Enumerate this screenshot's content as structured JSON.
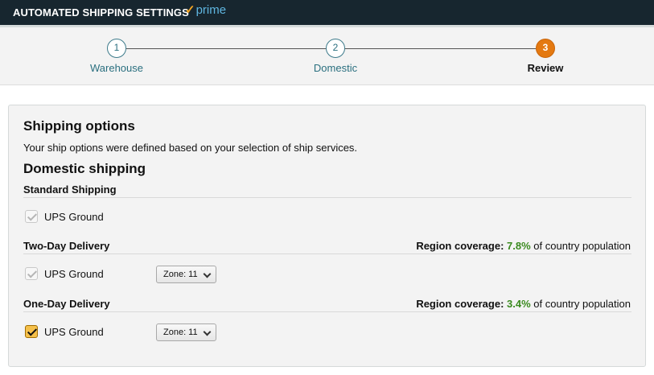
{
  "header": {
    "title": "AUTOMATED SHIPPING SETTINGS",
    "prime_check": "✓",
    "prime_label": "prime",
    "colors": {
      "background": "#17262f",
      "prime": "#5fb6e0",
      "check": "#f5a623"
    }
  },
  "stepper": {
    "steps": [
      {
        "number": "1",
        "label": "Warehouse",
        "state": "done"
      },
      {
        "number": "2",
        "label": "Domestic",
        "state": "done"
      },
      {
        "number": "3",
        "label": "Review",
        "state": "active"
      }
    ],
    "active_color": "#e47911"
  },
  "shipping_options": {
    "heading": "Shipping options",
    "description": "Your ship options were defined based on your selection of ship services.",
    "domestic_heading": "Domestic shipping",
    "groups": [
      {
        "title": "Standard Shipping",
        "option_label": "UPS Ground",
        "checked": true,
        "disabled": true
      },
      {
        "title": "Two-Day Delivery",
        "coverage_label": "Region coverage:",
        "coverage_value": "7.8%",
        "coverage_suffix": "of country population",
        "option_label": "UPS Ground",
        "checked": true,
        "disabled": true,
        "zone_value": "Zone: 11"
      },
      {
        "title": "One-Day Delivery",
        "coverage_label": "Region coverage:",
        "coverage_value": "3.4%",
        "coverage_suffix": "of country population",
        "option_label": "UPS Ground",
        "checked": true,
        "disabled": false,
        "zone_value": "Zone: 11"
      }
    ],
    "coverage_color": "#3a8a1f"
  }
}
